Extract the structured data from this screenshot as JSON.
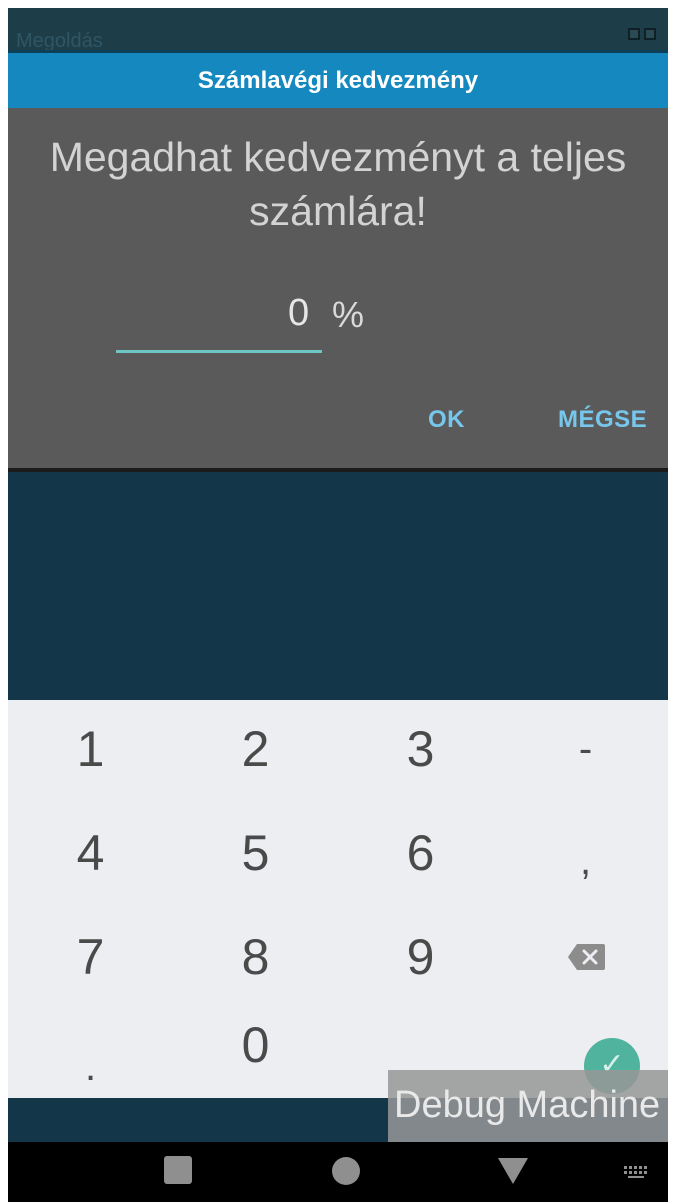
{
  "dialog": {
    "title": "Számlavégi kedvezmény",
    "message": "Megadhat kedvezményt a teljes számlára!",
    "discount_value": "0",
    "unit": "%",
    "ok_label": "OK",
    "cancel_label": "MÉGSE"
  },
  "status_strip": {
    "ghost_text": "Megoldás"
  },
  "keypad": {
    "keys": [
      "1",
      "2",
      "3",
      "-",
      "4",
      "5",
      "6",
      ",",
      "7",
      "8",
      "9",
      "backspace",
      ".",
      "0",
      "",
      "done"
    ],
    "done_icon": "check-icon",
    "backspace_icon": "backspace-icon"
  },
  "overlay": {
    "debug_label": "Debug Machine"
  },
  "navbar": {
    "icons": [
      "recents-icon",
      "home-icon",
      "back-icon",
      "keyboard-icon"
    ]
  },
  "colors": {
    "dialog_header": "#1589bf",
    "dialog_body": "#5a5a5a",
    "button_text": "#77c6ec",
    "input_underline": "#6ec7c4",
    "background": "#133649",
    "keypad": "#eceef1",
    "done_button": "#4fb39d"
  }
}
